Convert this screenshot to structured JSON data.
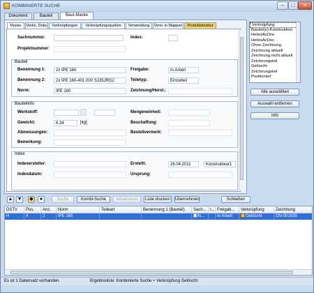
{
  "window": {
    "title": "KOMBINIERTE SUCHE"
  },
  "top_tabs": [
    "Dokument",
    "Bauteil",
    "Baut-Maske"
  ],
  "sub_tabs": [
    "Maske",
    "Verkn. Doku",
    "Verknüpfungen",
    "Verknüpfungsquellen",
    "Verwendung",
    "Verw. in Mappen",
    "Produktstruktur"
  ],
  "header": {
    "sachnummer_label": "Sachnummer:",
    "sachnummer_value": "",
    "index_label": "Index:",
    "projektnummer_label": "Projektnummer:"
  },
  "bauteil": {
    "title": "Bauteil",
    "benennung1_label": "Benennung 1:",
    "benennung1_value": "2x IPE 160",
    "freigabe_label": "Freigabe:",
    "freigabe_value": "In Arbeit",
    "benennung2_label": "Benennung 2:",
    "benennung2_value": "2x IPE 160-401.000 S235JRG2",
    "teiletyp_label": "Teiletyp:",
    "teiletyp_value": "Einzelteil",
    "norm_label": "Norm:",
    "norm_value": "IPE 160",
    "zeichnung_label": "Zeichnung/Herst.:"
  },
  "bauteilinfo": {
    "title": "Bauteilinfo",
    "werkstoff_label": "Werkstoff:",
    "mengeneinheit_label": "Mengeneinheit:",
    "gewicht_label": "Gewicht:",
    "gewicht_value": "6.34",
    "gewicht_unit": "[kg]",
    "beschaffung_label": "Beschaffung:",
    "abmessungen_label": "Abmessungen:",
    "bestellvermerk_label": "Bestellvermerk:",
    "bemerkung_label": "Bemerkung:"
  },
  "index_section": {
    "title": "Index",
    "indexersteller_label": "Indexersteller:",
    "erstellt_label": "Erstellt:",
    "erstellt_value": "26.04.2011",
    "erstellt_by": "Konstrukteur1",
    "indexdatum_label": "Indexdatum:",
    "ursprung_label": "Ursprung:"
  },
  "right_list": {
    "items": [
      "Verknüpfung",
      "Bauteil(e)-Konstruktion",
      "HeliosAcDrw",
      "HeliosAcDoc",
      "Ohne Zeichnung",
      "Zeichnung aktuell",
      "Zeichnung nicht aktuell",
      "Zeichnungsteil",
      "Gelöscht",
      "Zeichnungsteil",
      "Positioniert"
    ]
  },
  "right_buttons": {
    "select_all": "Alle auswählen",
    "remove_selection": "Auswahl entfernen",
    "info": "Info"
  },
  "toolbar": {
    "suche": "Suche",
    "kombi_suche": "Kombi-Suche",
    "initialisieren": "Initialisieren",
    "liste_drucken": "Liste drucken",
    "uebernehmen": "Übernehmen",
    "schliessen": "Schließen"
  },
  "grid": {
    "columns": [
      "DSTV",
      "Pos.",
      "Anz.",
      "Norm",
      "Teileart",
      "Benennung 1 (Bauteil)",
      "Sach...",
      "I...",
      "Freigab...",
      "Verknüpfung",
      "Zeichnung"
    ],
    "rows": [
      [
        "H",
        "4",
        "2",
        "IPE 160",
        "",
        "",
        "IN...",
        "",
        "In Arbeit",
        "Gelöscht",
        "DN-001639"
      ]
    ]
  },
  "status": {
    "left": "Es ist 1 Datensatz vorhanden.",
    "right": "Ergebnisliste: Kombinierte Suche + Verknüpfung Gelöscht"
  }
}
